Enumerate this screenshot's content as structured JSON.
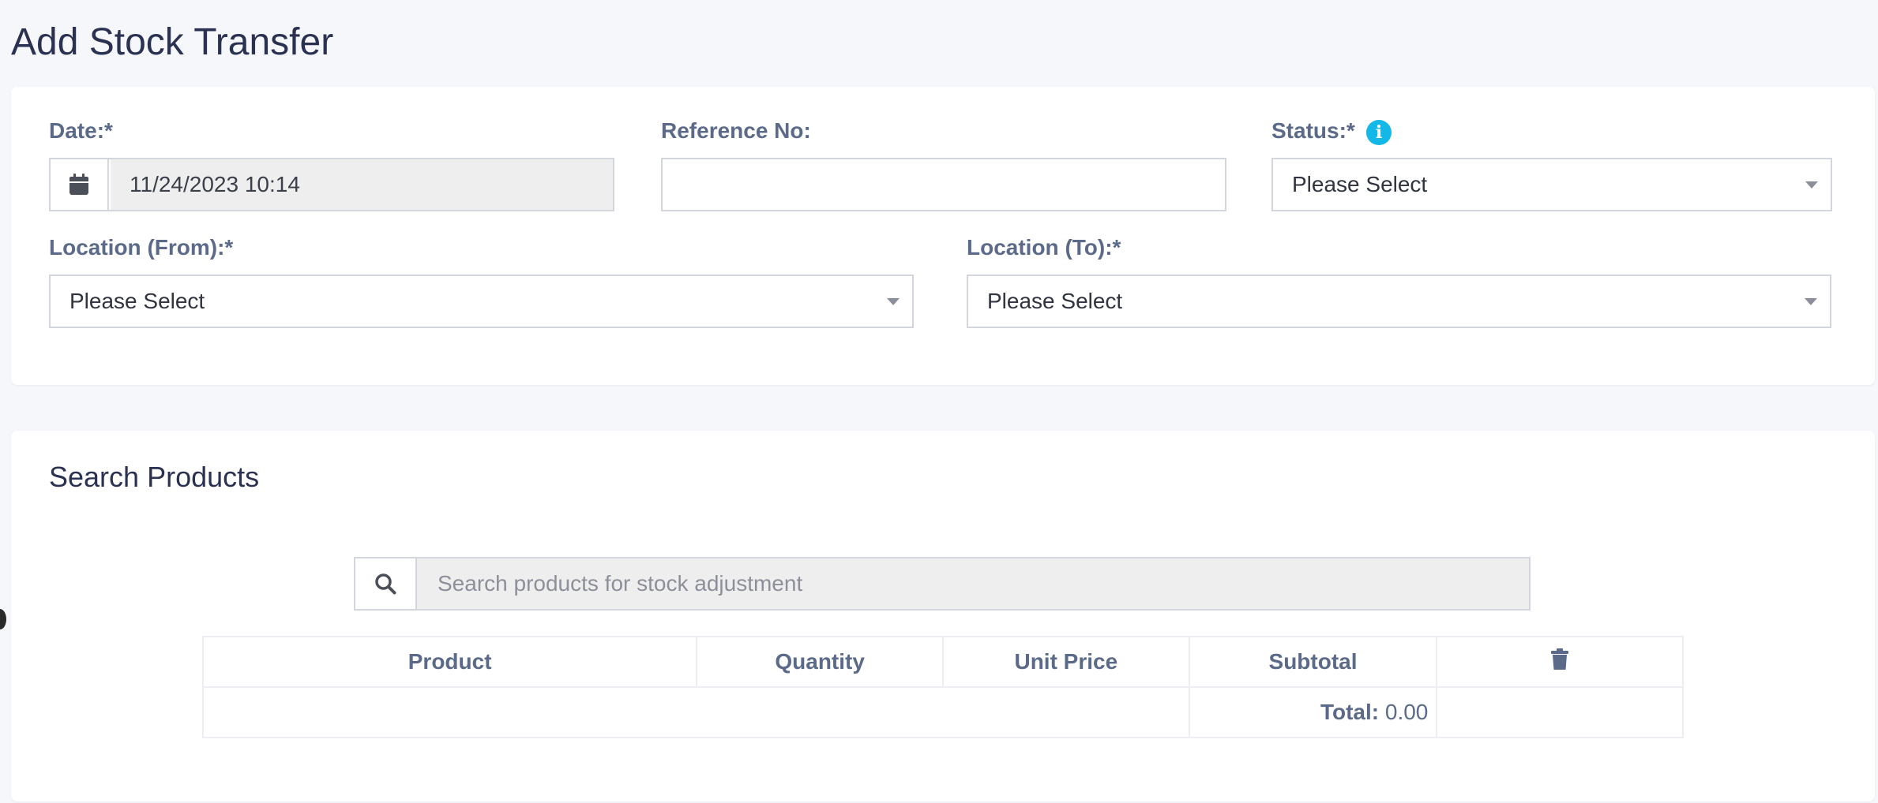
{
  "page": {
    "title": "Add Stock Transfer"
  },
  "form": {
    "date": {
      "label": "Date:*",
      "value": "11/24/2023 10:14",
      "icon": "calendar-icon"
    },
    "reference": {
      "label": "Reference No:",
      "value": ""
    },
    "status": {
      "label": "Status:*",
      "info_icon": "info-icon",
      "info_glyph": "i",
      "selected": "Please Select"
    },
    "location_from": {
      "label": "Location (From):*",
      "selected": "Please Select"
    },
    "location_to": {
      "label": "Location (To):*",
      "selected": "Please Select"
    }
  },
  "search_section": {
    "title": "Search Products",
    "search": {
      "placeholder": "Search products for stock adjustment",
      "icon": "search-icon"
    },
    "table": {
      "headers": [
        "Product",
        "Quantity",
        "Unit Price",
        "Subtotal"
      ],
      "delete_icon": "trash-icon",
      "total_label": "Total:",
      "total_value": "0.00"
    }
  },
  "colors": {
    "background": "#f6f7fb",
    "title": "#2b3151",
    "label": "#5a6a88",
    "info_accent": "#14b8e6",
    "input_readonly": "#eeeeee"
  }
}
